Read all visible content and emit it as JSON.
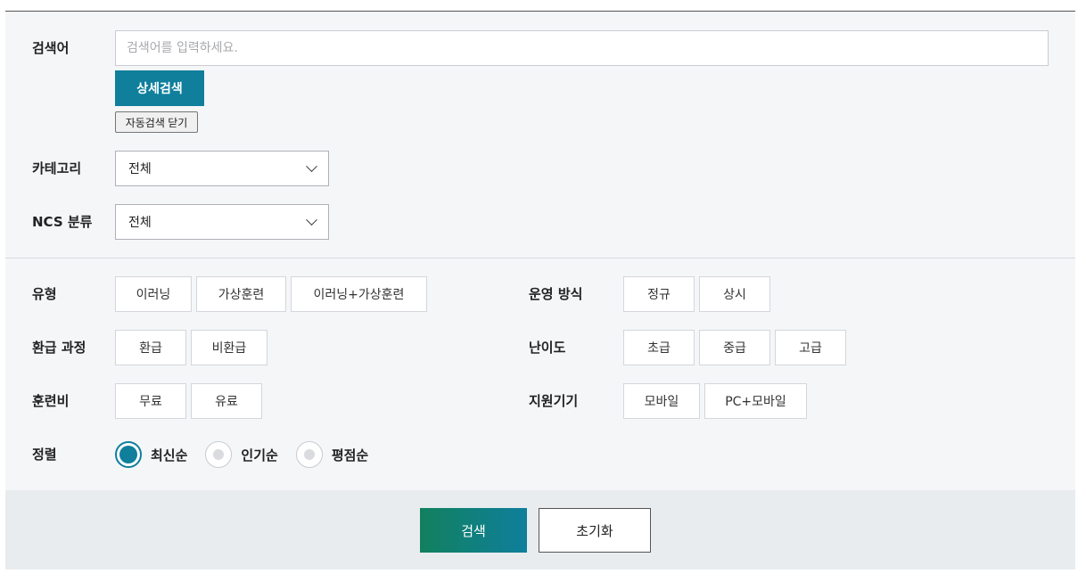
{
  "search": {
    "label": "검색어",
    "placeholder": "검색어를 입력하세요.",
    "detail_button": "상세검색",
    "auto_close_button": "자동검색 닫기"
  },
  "category": {
    "label": "카테고리",
    "selected": "전체"
  },
  "ncs": {
    "label": "NCS 분류",
    "selected": "전체"
  },
  "type": {
    "label": "유형",
    "options": [
      "이러닝",
      "가상훈련",
      "이러닝+가상훈련"
    ]
  },
  "operation": {
    "label": "운영 방식",
    "options": [
      "정규",
      "상시"
    ]
  },
  "refund": {
    "label": "환급 과정",
    "options": [
      "환급",
      "비환급"
    ]
  },
  "difficulty": {
    "label": "난이도",
    "options": [
      "초급",
      "중급",
      "고급"
    ]
  },
  "fee": {
    "label": "훈련비",
    "options": [
      "무료",
      "유료"
    ]
  },
  "device": {
    "label": "지원기기",
    "options": [
      "모바일",
      "PC+모바일"
    ]
  },
  "sort": {
    "label": "정렬",
    "options": [
      "최신순",
      "인기순",
      "평점순"
    ],
    "selected": "최신순"
  },
  "actions": {
    "submit": "검색",
    "reset": "초기화"
  },
  "colors": {
    "accent": "#0f7f9c",
    "accent_green": "#12805e"
  }
}
